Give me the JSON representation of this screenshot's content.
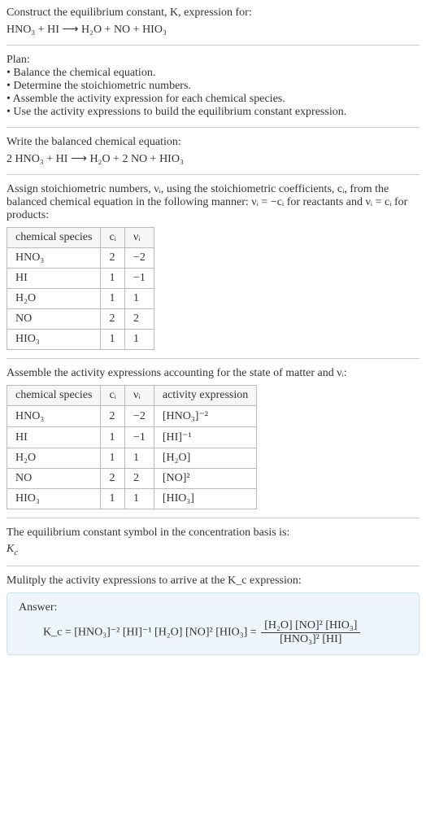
{
  "intro": {
    "prompt_line1": "Construct the equilibrium constant, K, expression for:",
    "equation": "HNO₃ + HI ⟶ H₂O + NO + HIO₃"
  },
  "plan": {
    "heading": "Plan:",
    "b1": "• Balance the chemical equation.",
    "b2": "• Determine the stoichiometric numbers.",
    "b3": "• Assemble the activity expression for each chemical species.",
    "b4": "• Use the activity expressions to build the equilibrium constant expression."
  },
  "balanced": {
    "heading": "Write the balanced chemical equation:",
    "equation": "2 HNO₃ + HI ⟶ H₂O + 2 NO + HIO₃"
  },
  "stoich": {
    "text_a": "Assign stoichiometric numbers, νᵢ, using the stoichiometric coefficients, cᵢ, from the balanced chemical equation in the following manner: νᵢ = −cᵢ for reactants and νᵢ = cᵢ for products:",
    "h_species": "chemical species",
    "h_ci": "cᵢ",
    "h_vi": "νᵢ",
    "r1s": "HNO₃",
    "r1c": "2",
    "r1v": "−2",
    "r2s": "HI",
    "r2c": "1",
    "r2v": "−1",
    "r3s": "H₂O",
    "r3c": "1",
    "r3v": "1",
    "r4s": "NO",
    "r4c": "2",
    "r4v": "2",
    "r5s": "HIO₃",
    "r5c": "1",
    "r5v": "1"
  },
  "activity": {
    "heading": "Assemble the activity expressions accounting for the state of matter and νᵢ:",
    "h_species": "chemical species",
    "h_ci": "cᵢ",
    "h_vi": "νᵢ",
    "h_act": "activity expression",
    "r1s": "HNO₃",
    "r1c": "2",
    "r1v": "−2",
    "r1a": "[HNO₃]⁻²",
    "r2s": "HI",
    "r2c": "1",
    "r2v": "−1",
    "r2a": "[HI]⁻¹",
    "r3s": "H₂O",
    "r3c": "1",
    "r3v": "1",
    "r3a": "[H₂O]",
    "r4s": "NO",
    "r4c": "2",
    "r4v": "2",
    "r4a": "[NO]²",
    "r5s": "HIO₃",
    "r5c": "1",
    "r5v": "1",
    "r5a": "[HIO₃]"
  },
  "kc_symbol": {
    "line": "The equilibrium constant symbol in the concentration basis is:",
    "sym": "K_c"
  },
  "final": {
    "heading": "Mulitply the activity expressions to arrive at the K_c expression:",
    "answer_label": "Answer:",
    "lhs": "K_c = [HNO₃]⁻² [HI]⁻¹ [H₂O] [NO]² [HIO₃] = ",
    "num": "[H₂O] [NO]² [HIO₃]",
    "den": "[HNO₃]² [HI]"
  }
}
